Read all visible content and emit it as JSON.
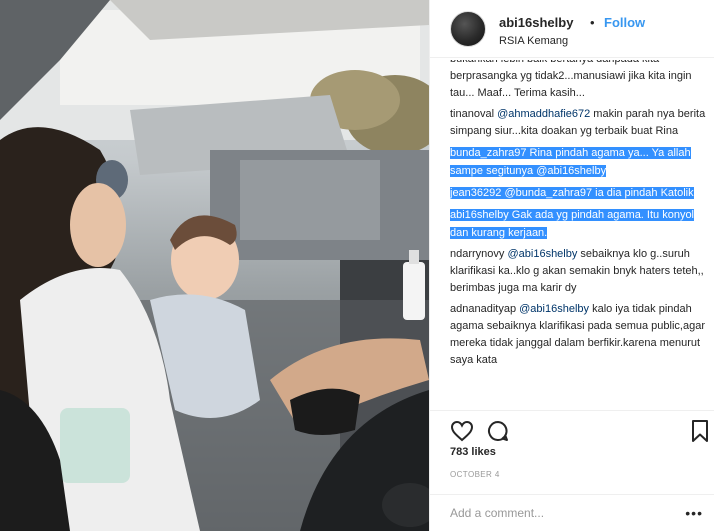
{
  "header": {
    "username": "abi16shelby",
    "separator": "•",
    "follow_label": "Follow",
    "location": "RSIA Kemang"
  },
  "comments": [
    {
      "user": "",
      "mention": "",
      "text": "bukankah lebih baik bertanya daripada kita berprasangka yg tidak2...manusiawi jika kita ingin tau... Maaf... Terima kasih..."
    },
    {
      "user": "tinanoval",
      "mention": "@ahmaddhafie672",
      "text": " makin parah nya berita simpang siur...kita doakan yg terbaik buat Rina"
    },
    {
      "user": "bunda_zahra97",
      "mention": "",
      "text": " Rina pindah agama ya... Ya allah sampe segitunya ",
      "mention2": "@abi16shelby"
    },
    {
      "user": "jean36292",
      "mention": "@bunda_zahra97",
      "text": " ia dia pindah Katolik"
    },
    {
      "user": "abi16shelby",
      "mention": "",
      "text": " Gak ada yg pindah agama. Itu konyol dan kurang kerjaan."
    },
    {
      "user": "ndarrynovy",
      "mention": "@abi16shelby",
      "text": " sebaiknya klo g..suruh klarifikasi ka..klo g akan semakin bnyk haters teteh,, berimbas juga ma karir dy"
    },
    {
      "user": "adnanadityap",
      "mention": "@abi16shelby",
      "text": " kalo iya tidak pindah agama sebaiknya klarifikasi pada semua public,agar mereka tidak janggal dalam berfikir.karena menurut saya kata"
    }
  ],
  "icons": {
    "like": "heart-icon",
    "comment": "comment-icon",
    "save": "bookmark-icon",
    "options": "more-options-icon"
  },
  "likes": "783 likes",
  "date": "OCTOBER 4",
  "add_comment": {
    "placeholder": "Add a comment...",
    "more": "•••"
  },
  "colors": {
    "link": "#3897f0",
    "mention": "#003569",
    "selection": "#3390ff"
  }
}
